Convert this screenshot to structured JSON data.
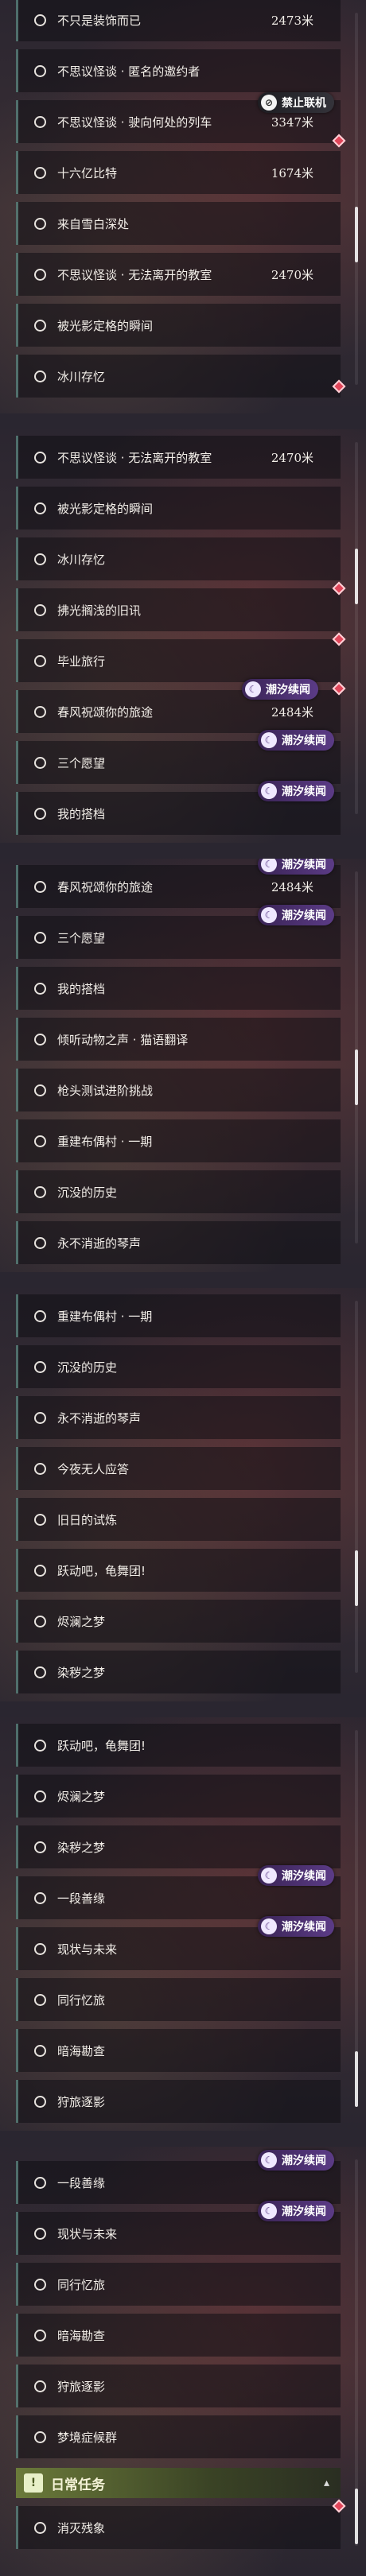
{
  "tags": {
    "relay": "潮汐续闻",
    "forbid": "禁止联机"
  },
  "panels": [
    {
      "rows": [
        {
          "label": "不只是装饰而已",
          "dist": "2473米"
        },
        {
          "label": "不思议怪谈 · 匿名的邀约者",
          "dist": ""
        },
        {
          "label": "不思议怪谈 · 驶向何处的列车",
          "dist": "3347米"
        },
        {
          "label": "十六亿比特",
          "dist": "1674米"
        },
        {
          "label": "来自雪白深处",
          "dist": ""
        },
        {
          "label": "不思议怪谈 · 无法离开的教室",
          "dist": "2470米"
        },
        {
          "label": "被光影定格的瞬间",
          "dist": ""
        },
        {
          "label": "冰川存忆",
          "dist": ""
        }
      ]
    },
    {
      "rows": [
        {
          "label": "不思议怪谈 · 无法离开的教室",
          "dist": "2470米"
        },
        {
          "label": "被光影定格的瞬间",
          "dist": ""
        },
        {
          "label": "冰川存忆",
          "dist": ""
        },
        {
          "label": "拂光搁浅的旧讯",
          "dist": ""
        },
        {
          "label": "毕业旅行",
          "dist": ""
        },
        {
          "label": "春风祝颂你的旅途",
          "dist": "2484米"
        },
        {
          "label": "三个愿望",
          "dist": ""
        },
        {
          "label": "我的搭档",
          "dist": ""
        }
      ]
    },
    {
      "rows": [
        {
          "label": "春风祝颂你的旅途",
          "dist": "2484米"
        },
        {
          "label": "三个愿望",
          "dist": ""
        },
        {
          "label": "我的搭档",
          "dist": ""
        },
        {
          "label": "倾听动物之声 · 猫语翻译",
          "dist": ""
        },
        {
          "label": "枪头测试进阶挑战",
          "dist": ""
        },
        {
          "label": "重建布偶村 · 一期",
          "dist": ""
        },
        {
          "label": "沉没的历史",
          "dist": ""
        },
        {
          "label": "永不消逝的琴声",
          "dist": ""
        }
      ]
    },
    {
      "rows": [
        {
          "label": "重建布偶村 · 一期",
          "dist": ""
        },
        {
          "label": "沉没的历史",
          "dist": ""
        },
        {
          "label": "永不消逝的琴声",
          "dist": ""
        },
        {
          "label": "今夜无人应答",
          "dist": ""
        },
        {
          "label": "旧日的试炼",
          "dist": ""
        },
        {
          "label": "跃动吧，龟舞团!",
          "dist": ""
        },
        {
          "label": "烬澜之梦",
          "dist": ""
        },
        {
          "label": "染秽之梦",
          "dist": ""
        }
      ]
    },
    {
      "rows": [
        {
          "label": "跃动吧，龟舞团!",
          "dist": ""
        },
        {
          "label": "烬澜之梦",
          "dist": ""
        },
        {
          "label": "染秽之梦",
          "dist": ""
        },
        {
          "label": "一段善缘",
          "dist": ""
        },
        {
          "label": "现状与未来",
          "dist": ""
        },
        {
          "label": "同行忆旅",
          "dist": ""
        },
        {
          "label": "暗海勘查",
          "dist": ""
        },
        {
          "label": "狩旅逐影",
          "dist": ""
        }
      ]
    },
    {
      "rows": [
        {
          "label": "一段善缘",
          "dist": ""
        },
        {
          "label": "现状与未来",
          "dist": ""
        },
        {
          "label": "同行忆旅",
          "dist": ""
        },
        {
          "label": "暗海勘查",
          "dist": ""
        },
        {
          "label": "狩旅逐影",
          "dist": ""
        },
        {
          "label": "梦境症候群",
          "dist": ""
        }
      ],
      "header": {
        "title": "日常任务",
        "icon": "!"
      },
      "after_header": [
        {
          "label": "消灭残象",
          "dist": ""
        }
      ]
    }
  ]
}
